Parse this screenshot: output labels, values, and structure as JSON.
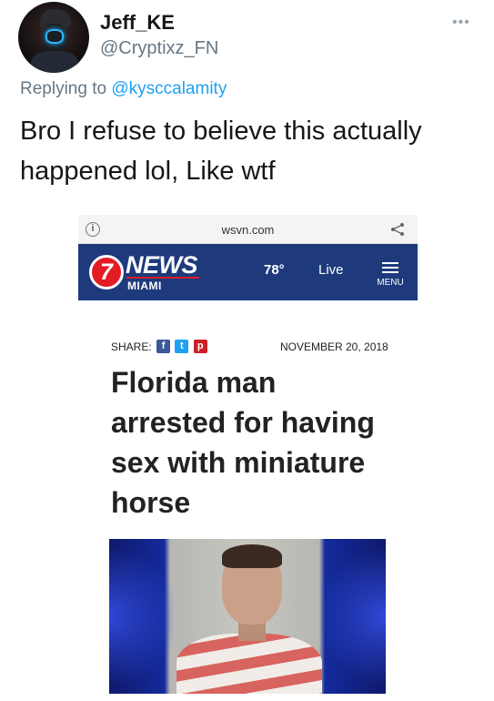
{
  "tweet": {
    "display_name": "Jeff_KE",
    "handle": "@Cryptixz_FN",
    "reply_prefix": "Replying to",
    "reply_mention": "@kysccalamity",
    "text": "Bro I refuse to believe this actually happened lol, Like wtf",
    "more_icon": "more-horizontal-icon"
  },
  "screenshot": {
    "url": "wsvn.com",
    "icons": {
      "info": "info-icon",
      "share": "share-icon",
      "menu": "hamburger-menu-icon"
    },
    "nav": {
      "logo_number": "7",
      "logo_news": "NEWS",
      "logo_city": "MIAMI",
      "temperature": "78°",
      "live_label": "Live",
      "menu_label": "MENU",
      "bg_color": "#1e3a7d",
      "accent_color": "#e31b23"
    },
    "article": {
      "share_label": "SHARE:",
      "social": [
        "f",
        "t",
        "p"
      ],
      "date": "NOVEMBER 20, 2018",
      "headline": "Florida man arrested for having sex with miniature horse"
    }
  }
}
